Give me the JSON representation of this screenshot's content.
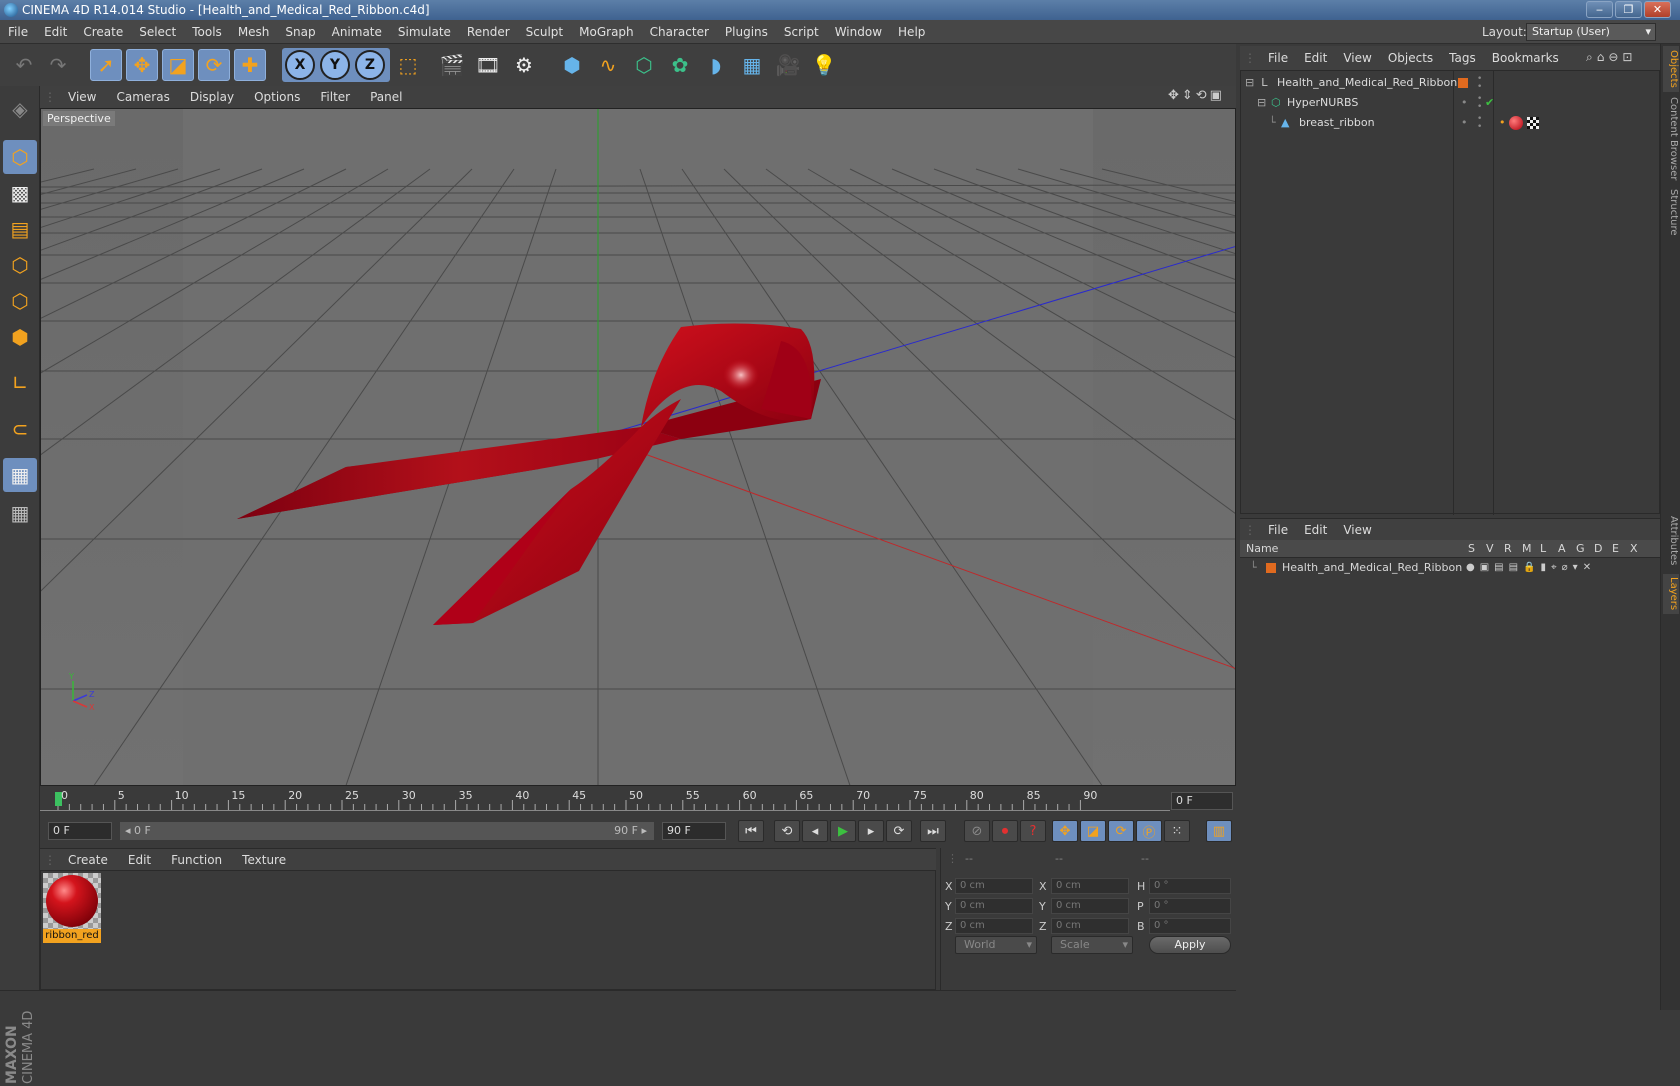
{
  "window": {
    "title": "CINEMA 4D R14.014 Studio - [Health_and_Medical_Red_Ribbon.c4d]",
    "buttons": [
      "‒",
      "❐",
      "✕"
    ]
  },
  "menubar": {
    "items": [
      "File",
      "Edit",
      "Create",
      "Select",
      "Tools",
      "Mesh",
      "Snap",
      "Animate",
      "Simulate",
      "Render",
      "Sculpt",
      "MoGraph",
      "Character",
      "Plugins",
      "Script",
      "Window",
      "Help"
    ],
    "layout_label": "Layout:",
    "layout_value": "Startup (User)"
  },
  "viewport": {
    "menu": [
      "View",
      "Cameras",
      "Display",
      "Options",
      "Filter",
      "Panel"
    ],
    "label": "Perspective",
    "axis_labels": {
      "y": "Y",
      "z": "Z",
      "x": "X"
    }
  },
  "timeline": {
    "ticks": [
      "0",
      "5",
      "10",
      "15",
      "20",
      "25",
      "30",
      "35",
      "40",
      "45",
      "50",
      "55",
      "60",
      "65",
      "70",
      "75",
      "80",
      "85",
      "90"
    ],
    "current_frame": "0 F",
    "start_field": "0 F",
    "range_start": "◂ 0 F",
    "range_end": "90 F ▸",
    "end_field": "90 F"
  },
  "material_manager": {
    "menu": [
      "Create",
      "Edit",
      "Function",
      "Texture"
    ],
    "materials": [
      {
        "name": "ribbon_red",
        "color": "#d4141c"
      }
    ]
  },
  "coordinates": {
    "headers": [
      "--",
      "--",
      "--"
    ],
    "rows": [
      {
        "l1": "X",
        "v1": "0 cm",
        "l2": "X",
        "v2": "0 cm",
        "l3": "H",
        "v3": "0 °"
      },
      {
        "l1": "Y",
        "v1": "0 cm",
        "l2": "Y",
        "v2": "0 cm",
        "l3": "P",
        "v3": "0 °"
      },
      {
        "l1": "Z",
        "v1": "0 cm",
        "l2": "Z",
        "v2": "0 cm",
        "l3": "B",
        "v3": "0 °"
      }
    ],
    "mode": "World",
    "transform": "Scale",
    "apply": "Apply"
  },
  "object_manager": {
    "menu": [
      "File",
      "Edit",
      "View",
      "Objects",
      "Tags",
      "Bookmarks"
    ],
    "objects": [
      {
        "name": "Health_and_Medical_Red_Ribbon",
        "icon": "null-icon"
      },
      {
        "name": "HyperNURBS",
        "icon": "hypernurbs-icon"
      },
      {
        "name": "breast_ribbon",
        "icon": "polygon-icon"
      }
    ]
  },
  "layer_manager": {
    "menu": [
      "File",
      "Edit",
      "View"
    ],
    "columns": [
      "Name",
      "S",
      "V",
      "R",
      "M",
      "L",
      "A",
      "G",
      "D",
      "E",
      "X"
    ],
    "layers": [
      {
        "name": "Health_and_Medical_Red_Ribbon",
        "color": "#e06a1f"
      }
    ]
  },
  "side_tabs": [
    "Objects",
    "Content Browser",
    "Structure",
    "Attributes",
    "Layers"
  ],
  "branding": {
    "maxon": "MAXON",
    "product": "CINEMA 4D"
  },
  "colors": {
    "accent": "#f2a21f",
    "selection": "#6e8fbe",
    "ribbon": "#b5101b"
  }
}
